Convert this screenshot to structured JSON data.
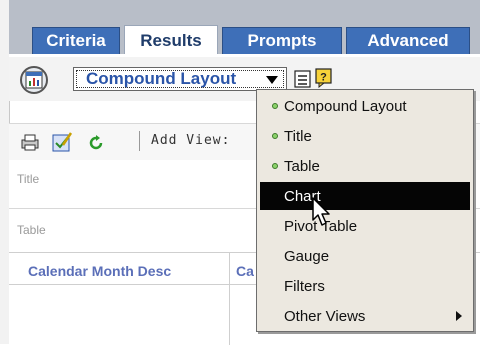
{
  "tabs": [
    {
      "label": "Criteria",
      "active": false
    },
    {
      "label": "Results",
      "active": true
    },
    {
      "label": "Prompts",
      "active": false
    },
    {
      "label": "Advanced",
      "active": false
    }
  ],
  "toolbar": {
    "layout_select_value": "Compound Layout",
    "add_view_label": "Add View:"
  },
  "sections": {
    "title_label": "Title",
    "table_label": "Table"
  },
  "table": {
    "columns": [
      "Calendar Month Desc",
      "Ca"
    ]
  },
  "menu": {
    "items": [
      {
        "label": "Compound Layout",
        "bullet": true
      },
      {
        "label": "Title",
        "bullet": true
      },
      {
        "label": "Table",
        "bullet": true
      },
      {
        "label": "Chart",
        "selected": true
      },
      {
        "label": "Pivot Table"
      },
      {
        "label": "Gauge"
      },
      {
        "label": "Filters"
      },
      {
        "label": "Other Views",
        "submenu": true
      }
    ]
  },
  "colors": {
    "tab_blue": "#3e6fb8",
    "select_text": "#2a54a8",
    "menu_selected": "#050505",
    "menu_bg": "#ece8e0"
  },
  "icons": [
    "view-selector-icon",
    "chevron-down-icon",
    "properties-icon",
    "help-icon",
    "print-icon",
    "edit-icon",
    "refresh-icon",
    "submenu-arrow-icon",
    "mouse-pointer-icon"
  ]
}
